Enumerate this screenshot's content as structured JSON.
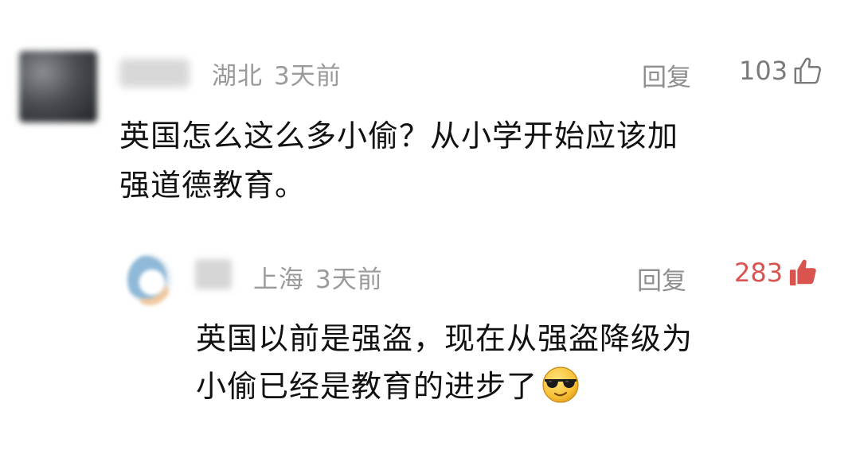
{
  "comments": [
    {
      "location": "湖北",
      "time": "3天前",
      "reply_label": "回复",
      "like_count": "103",
      "liked": false,
      "like_icon": "thumbs-up-outline-icon",
      "text_line1": "英国怎么这么多小偷？从小学开始应该加",
      "text_line2": "强道德教育。"
    },
    {
      "location": "上海",
      "time": "3天前",
      "reply_label": "回复",
      "like_count": "283",
      "liked": true,
      "like_icon": "thumbs-up-filled-icon",
      "text_line1": "英国以前是强盗，现在从强盗降级为",
      "text_line2": "小偷已经是教育的进步了",
      "emoji": "sunglasses-smile-emoji"
    }
  ],
  "colors": {
    "meta_gray": "#9a9a9a",
    "like_active": "#d9534f",
    "text": "#111111"
  }
}
